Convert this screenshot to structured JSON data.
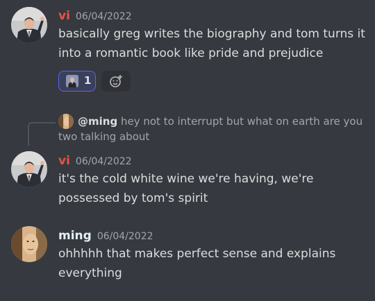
{
  "colors": {
    "background": "#36393f",
    "vi_name": "#e9533f",
    "ming_name": "#e6f0f5",
    "reaction_accent": "#5865f2"
  },
  "messages": [
    {
      "author": "vi",
      "timestamp": "06/04/2022",
      "text": "basically greg writes the biography and tom turns it into a romantic book like pride and prejudice",
      "reaction": {
        "emoji": "man-in-suit-emoji",
        "count": "1"
      },
      "add_reaction_icon": "add-reaction-icon"
    },
    {
      "reply": {
        "mention": "@ming",
        "text": "hey not to interrupt but what on earth are you two talking about"
      },
      "author": "vi",
      "timestamp": "06/04/2022",
      "text": "it's the cold white wine we're having, we're possessed by tom's spirit"
    },
    {
      "author": "ming",
      "timestamp": "06/04/2022",
      "text": "ohhhhh that makes perfect sense and explains everything"
    }
  ]
}
